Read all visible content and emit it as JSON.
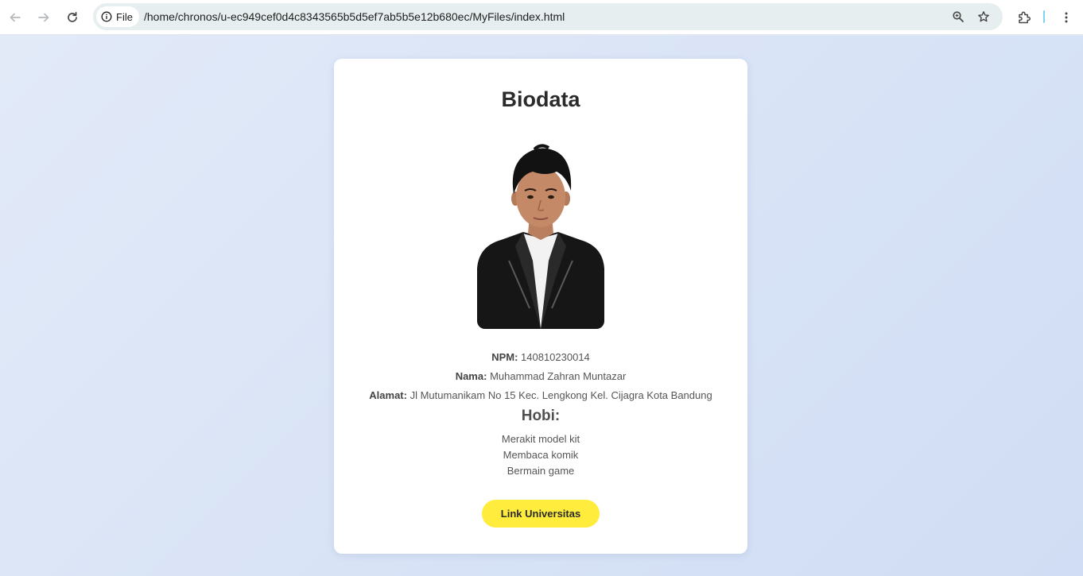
{
  "browser": {
    "chip_label": "File",
    "url": "/home/chronos/u-ec949cef0d4c8343565b5d5ef7ab5b5e12b680ec/MyFiles/index.html",
    "accent_color": "#7fd3f2"
  },
  "page": {
    "title": "Biodata",
    "npm_label": "NPM:",
    "npm_value": "140810230014",
    "nama_label": "Nama:",
    "nama_value": "Muhammad Zahran Muntazar",
    "alamat_label": "Alamat:",
    "alamat_value": "Jl Mutumanikam No 15 Kec. Lengkong Kel. Cijagra Kota Bandung",
    "hobi_title": "Hobi:",
    "hobbies": [
      "Merakit model kit",
      "Membaca komik",
      "Bermain game"
    ],
    "link_label": "Link Universitas",
    "button_color": "#ffec3d",
    "background_color": "#dfe8f8"
  }
}
